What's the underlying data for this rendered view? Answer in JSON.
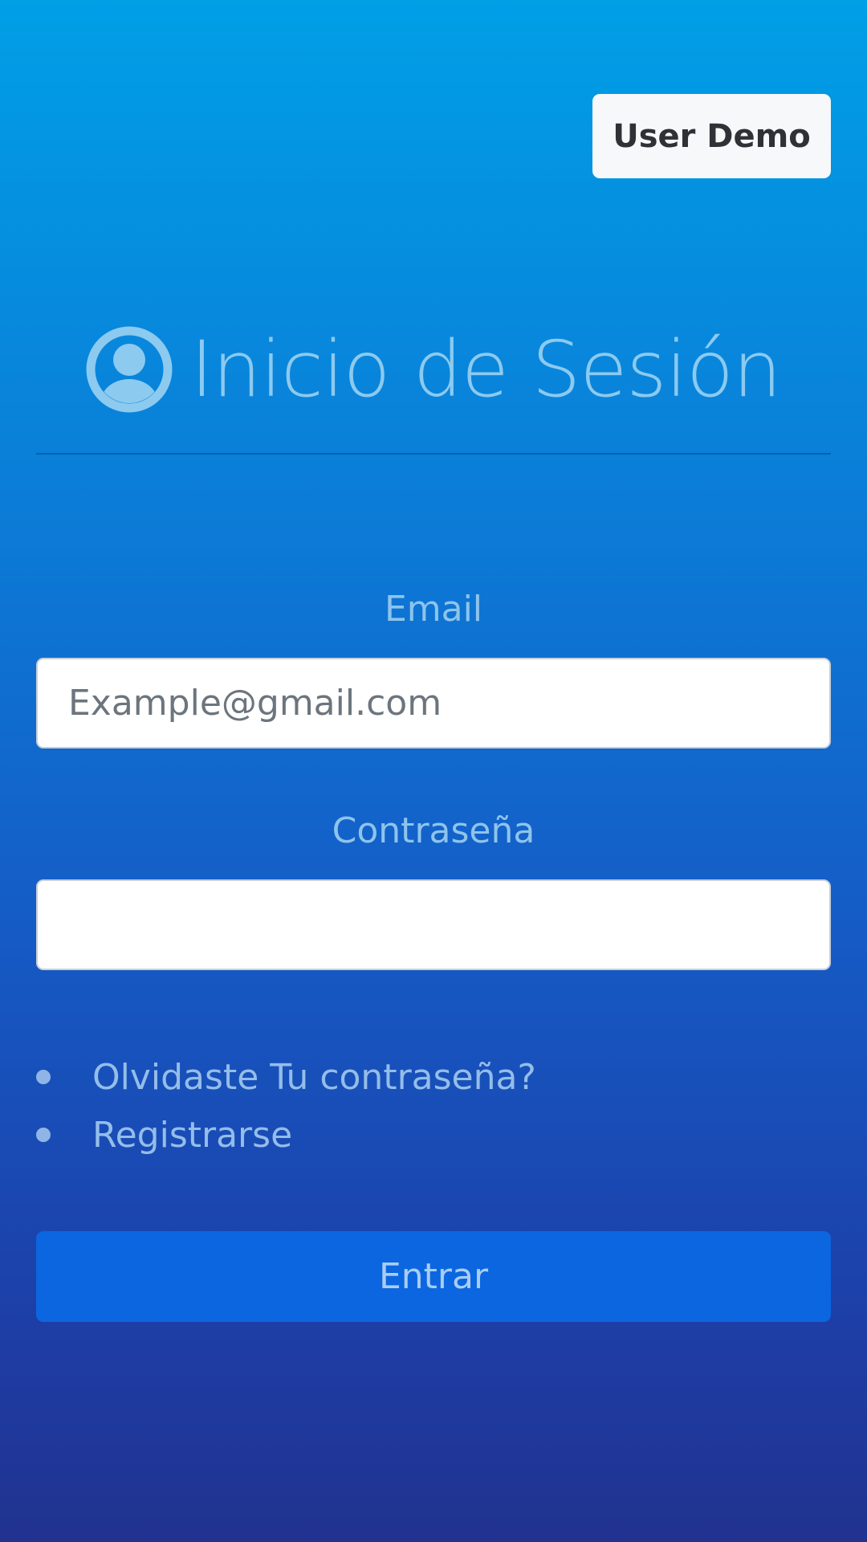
{
  "header": {
    "user_demo_label": "User Demo"
  },
  "login": {
    "title": "Inicio de Sesión",
    "title_icon": "user-circle-icon",
    "email_label": "Email",
    "email_placeholder": "Example@gmail.com",
    "email_value": "",
    "password_label": "Contraseña",
    "password_value": "",
    "links": [
      {
        "label": "Olvidaste Tu contraseña?"
      },
      {
        "label": "Registrarse"
      }
    ],
    "submit_label": "Entrar"
  },
  "colors": {
    "gradient_top": "#009fe6",
    "gradient_bottom": "#21328f",
    "title_color": "#8ccaf0",
    "submit_button": "#0b66e0",
    "user_demo_button": "#f7f8f9"
  }
}
